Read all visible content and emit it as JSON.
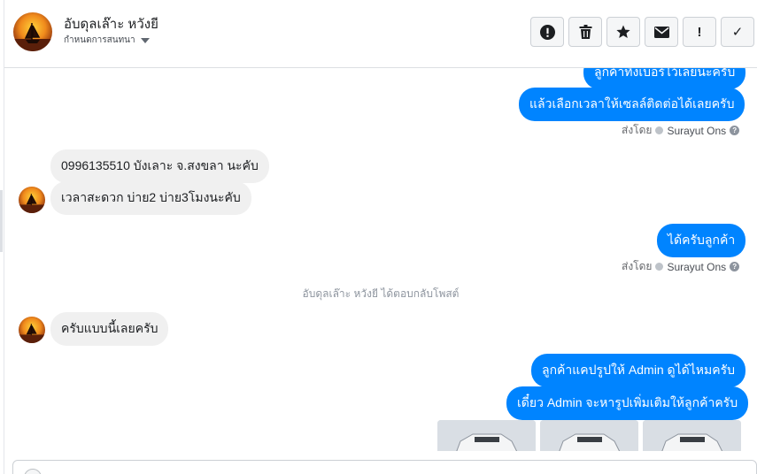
{
  "contact": {
    "name": "อับดุลเล๊าะ หวังยี",
    "subtitle": "กำหนดการสนทนา"
  },
  "toolbar": {
    "actions": [
      {
        "name": "report-button",
        "icon": "alert-circle-icon"
      },
      {
        "name": "delete-button",
        "icon": "trash-icon"
      },
      {
        "name": "star-button",
        "icon": "star-icon"
      },
      {
        "name": "mail-button",
        "icon": "envelope-icon"
      },
      {
        "name": "flag-important-button",
        "icon": "exclamation-icon",
        "label": "!"
      },
      {
        "name": "mark-done-button",
        "icon": "check-icon",
        "label": "✓"
      }
    ]
  },
  "messages": {
    "out_partial": "ลูกค้าทิ้งเบอร์ไว้เลยนะครับ",
    "out_1": "แล้วเลือกเวลาให้เซลล์ติดต่อได้เลยครับ",
    "sent_by_label": "ส่งโดย",
    "agent_name": "Surayut Ons",
    "in_1": "0996135510 บังเลาะ จ.สงขลา นะคับ",
    "in_2": "เวลาสะดวก บ่าย2 บ่าย3โมงนะคับ",
    "out_2": "ได้ครับลูกค้า",
    "notice": "อับดุลเล๊าะ หวังยี ได้ตอบกลับโพสต์",
    "in_3": "ครับแบบนี้เลยครับ",
    "out_3": "ลูกค้าแคปรูปให้ Admin ดูได้ไหมครับ",
    "out_4": "เดี๋ยว Admin จะหารูปเพิ่มเติมให้ลูกค้าครับ"
  },
  "colors": {
    "outgoing": "#0084ff",
    "incoming": "#f0f0f0"
  }
}
